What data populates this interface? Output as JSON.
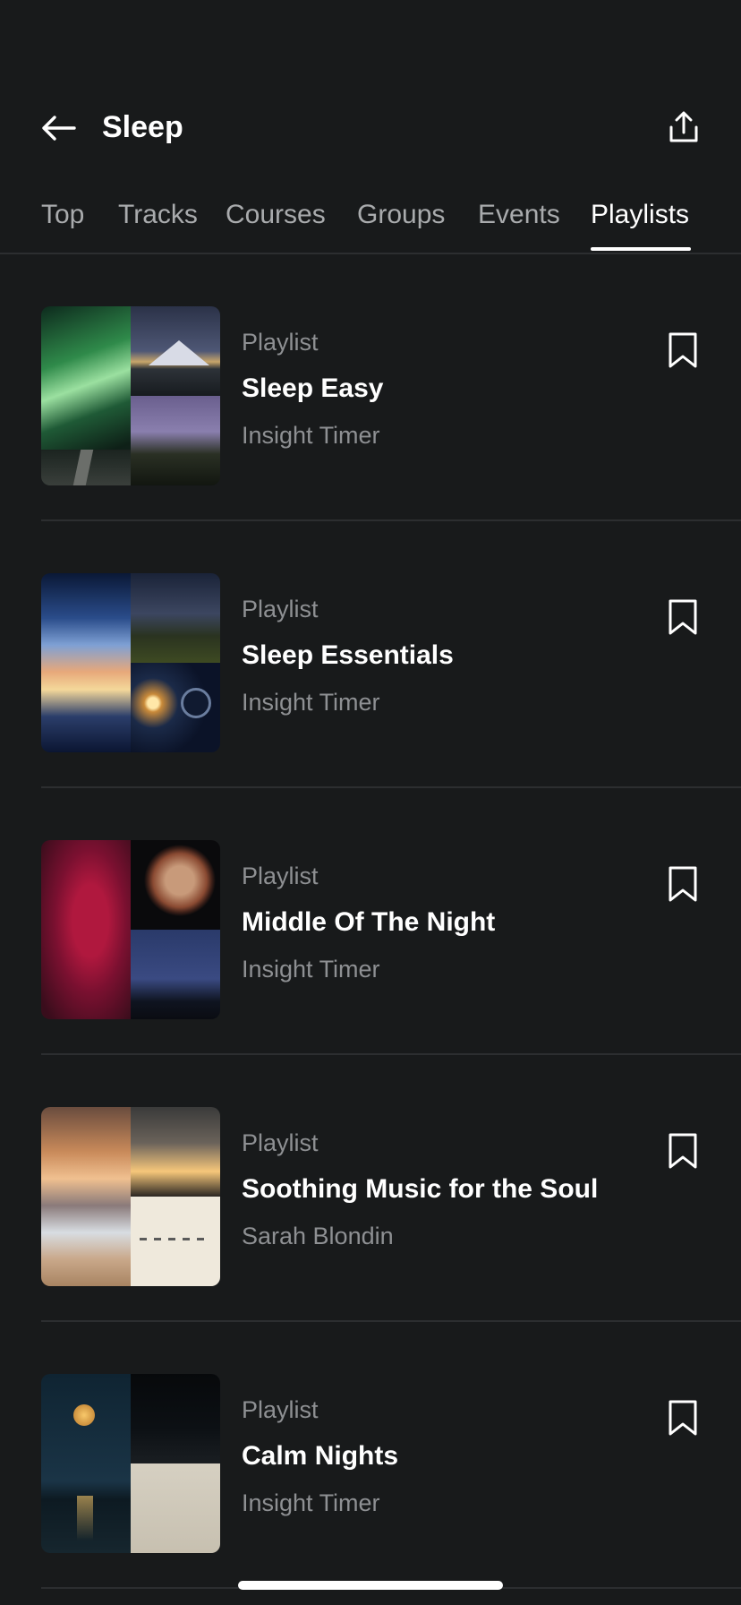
{
  "header": {
    "title": "Sleep",
    "back_icon": "arrow-left-icon",
    "share_icon": "share-icon"
  },
  "tabs": [
    {
      "label": "Top",
      "active": false
    },
    {
      "label": "Tracks",
      "active": false
    },
    {
      "label": "Courses",
      "active": false
    },
    {
      "label": "Groups",
      "active": false
    },
    {
      "label": "Events",
      "active": false
    },
    {
      "label": "Playlists",
      "active": true
    }
  ],
  "playlists": [
    {
      "kind": "Playlist",
      "title": "Sleep Easy",
      "author": "Insight Timer"
    },
    {
      "kind": "Playlist",
      "title": "Sleep Essentials",
      "author": "Insight Timer"
    },
    {
      "kind": "Playlist",
      "title": "Middle Of The Night",
      "author": "Insight Timer"
    },
    {
      "kind": "Playlist",
      "title": "Soothing Music for the Soul",
      "author": "Sarah Blondin"
    },
    {
      "kind": "Playlist",
      "title": "Calm Nights",
      "author": "Insight Timer"
    }
  ],
  "colors": {
    "background": "#181a1b",
    "text_primary": "#ffffff",
    "text_secondary": "#8e9093",
    "divider": "#2c2e30"
  }
}
